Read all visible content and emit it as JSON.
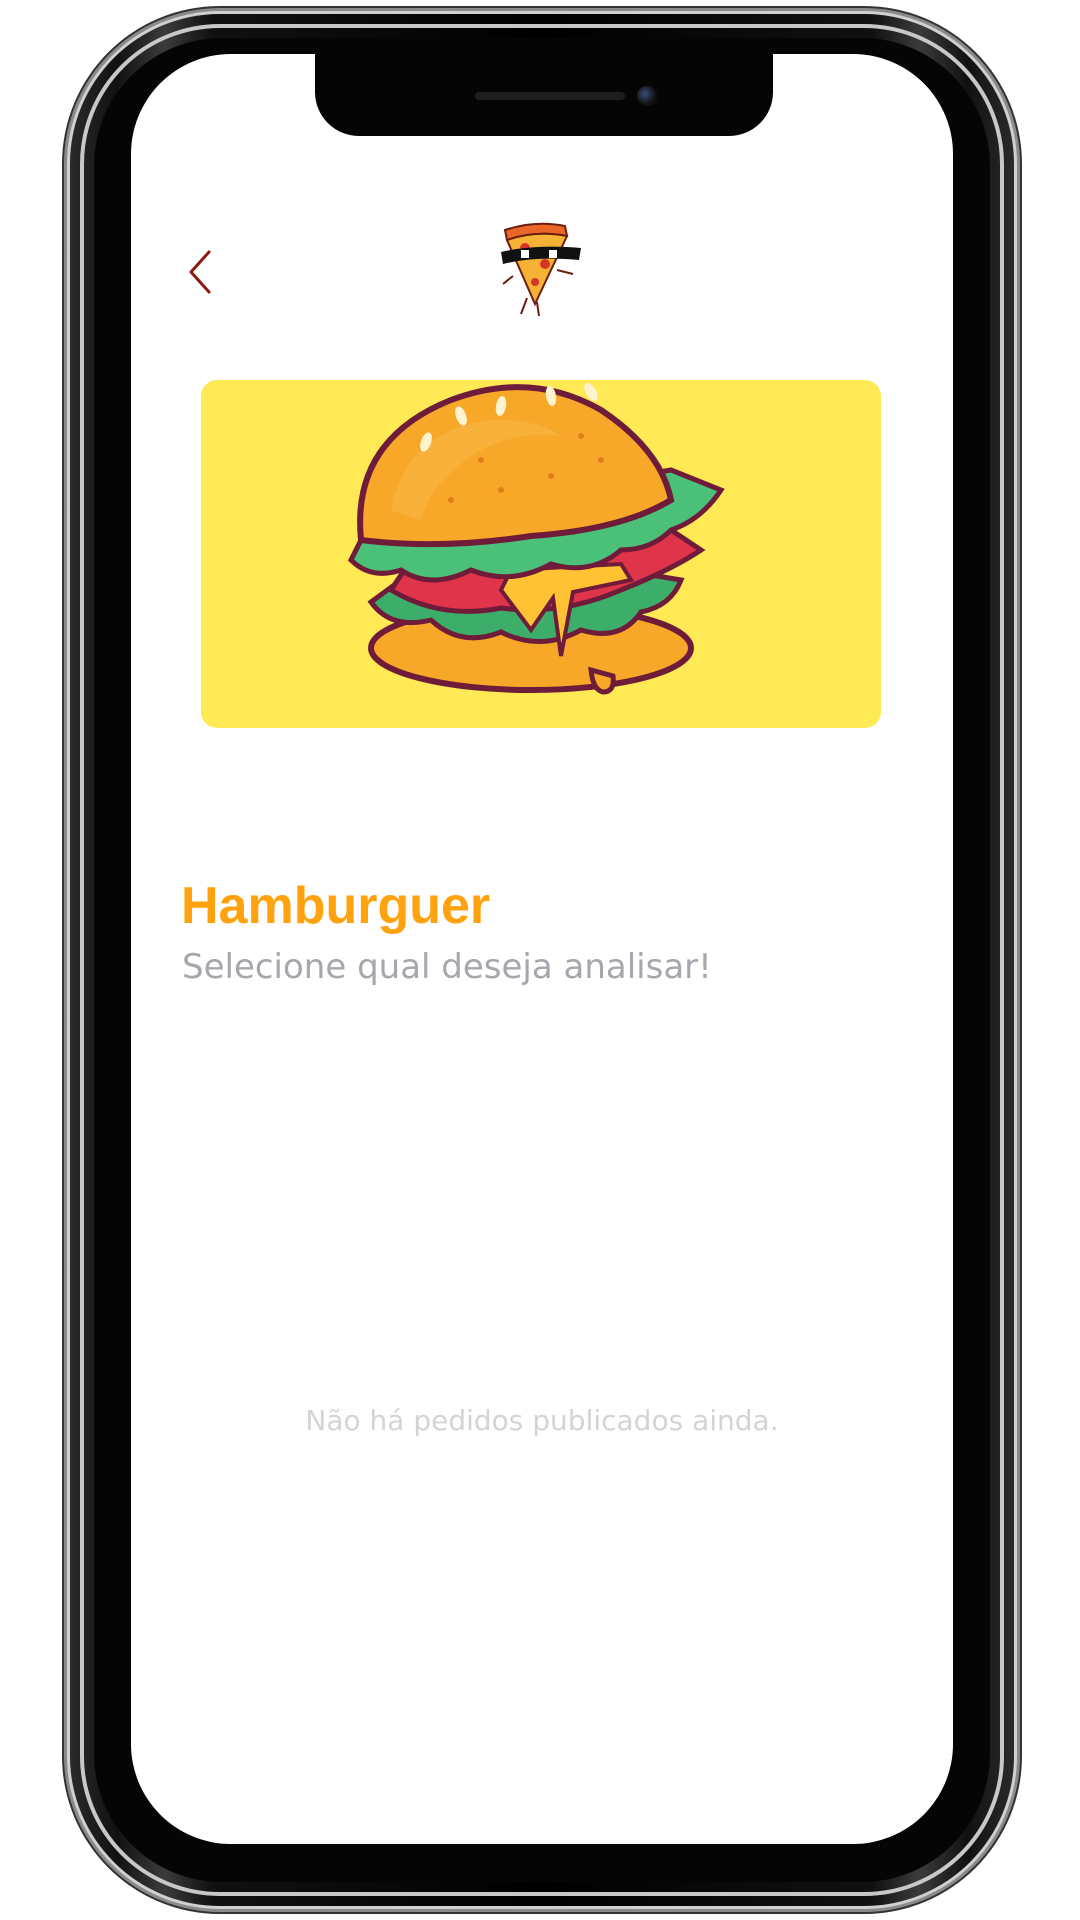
{
  "header": {
    "back_icon": "chevron-left-icon",
    "logo_icon": "pizza-slice-mascot-icon"
  },
  "banner": {
    "image": "hamburger-illustration",
    "background_color": "#ffea55"
  },
  "category": {
    "title": "Hamburguer",
    "subtitle": "Selecione qual deseja analisar!"
  },
  "orders": {
    "empty_message": "Não há pedidos publicados ainda."
  },
  "colors": {
    "accent": "#ffa20e",
    "back_icon": "#8b1a0f",
    "subtitle": "#a6a6ae",
    "empty_text": "#d4d4d8"
  }
}
